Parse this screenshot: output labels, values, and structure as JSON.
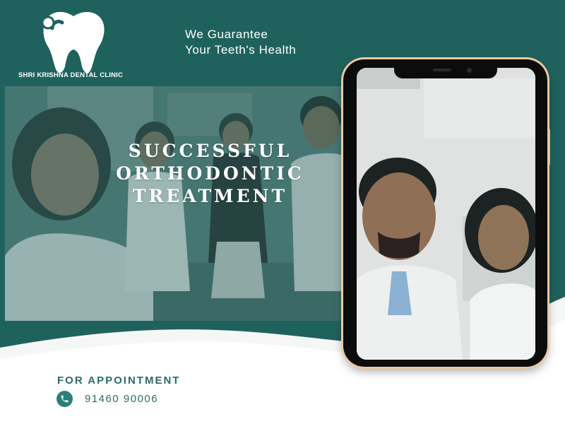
{
  "brand": {
    "clinic_name": "SHRI KRISHNA DENTAL CLINIC",
    "logo_icon": "tooth-icon"
  },
  "tagline": {
    "line1": "We Guarantee",
    "line2": "Your Teeth's Health"
  },
  "headline": {
    "line1": "SUCCESSFUL",
    "line2": "ORTHODONTIC",
    "line3": "TREATMENT"
  },
  "appointment": {
    "label": "FOR APPOINTMENT",
    "phone": "91460 90006",
    "icon": "phone-icon"
  },
  "colors": {
    "primary_teal": "#1f625d",
    "accent_teal": "#2a7f79",
    "phone_frame_gold": "#e9c9a3",
    "text_white": "#ffffff"
  }
}
